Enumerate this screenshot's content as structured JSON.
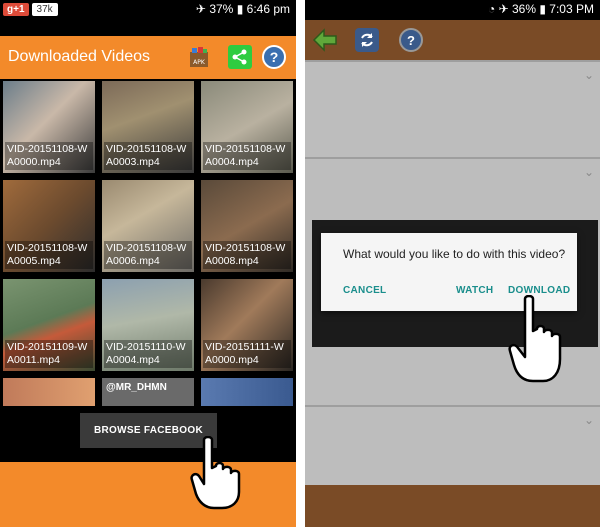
{
  "left": {
    "status": {
      "battery": "37%",
      "time": "6:46 pm"
    },
    "gplus": {
      "label": "g+1",
      "count": "37k"
    },
    "header": {
      "title": "Downloaded Videos"
    },
    "icons": {
      "apk": "apk-icon",
      "share": "share-icon",
      "help": "help-icon"
    },
    "videos": [
      {
        "name": "VID-20151108-WA0000.mp4"
      },
      {
        "name": "VID-20151108-WA0003.mp4"
      },
      {
        "name": "VID-20151108-WA0004.mp4"
      },
      {
        "name": "VID-20151108-WA0005.mp4"
      },
      {
        "name": "VID-20151108-WA0006.mp4"
      },
      {
        "name": "VID-20151108-WA0008.mp4"
      },
      {
        "name": "VID-20151109-WA0011.mp4"
      },
      {
        "name": "VID-20151110-WA0004.mp4"
      },
      {
        "name": "VID-20151111-WA0000.mp4"
      }
    ],
    "partial_tile_text": "@MR_DHMN",
    "browse_button": "BROWSE FACEBOOK"
  },
  "right": {
    "status": {
      "battery": "36%",
      "time": "7:03 PM"
    },
    "dialog": {
      "question": "What would you like to do with this video?",
      "cancel": "CANCEL",
      "watch": "WATCH",
      "download": "DOWNLOAD"
    }
  },
  "colors": {
    "accent": "#f38a2a",
    "brown": "#7a4b26",
    "teal": "#1a8e8c"
  }
}
